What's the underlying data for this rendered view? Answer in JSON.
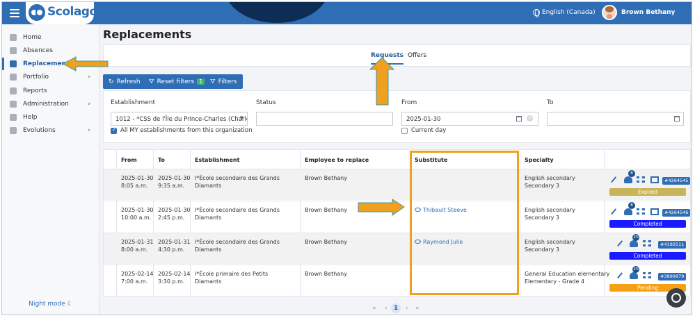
{
  "header": {
    "brand": "Scolago",
    "language": "English (Canada)",
    "user_name": "Brown Bethany"
  },
  "sidebar": {
    "items": [
      {
        "label": "Home",
        "icon": "home-icon",
        "has_submenu": false,
        "active": false
      },
      {
        "label": "Absences",
        "icon": "absences-icon",
        "has_submenu": false,
        "active": false
      },
      {
        "label": "Replacements",
        "icon": "replacements-icon",
        "has_submenu": false,
        "active": true
      },
      {
        "label": "Portfolio",
        "icon": "trophy-icon",
        "has_submenu": true,
        "active": false
      },
      {
        "label": "Reports",
        "icon": "document-icon",
        "has_submenu": false,
        "active": false
      },
      {
        "label": "Administration",
        "icon": "gear-icon",
        "has_submenu": true,
        "active": false
      },
      {
        "label": "Help",
        "icon": "question-icon",
        "has_submenu": false,
        "active": false
      },
      {
        "label": "Evolutions",
        "icon": "sprout-icon",
        "has_submenu": true,
        "active": false
      }
    ],
    "night_mode": "Night mode"
  },
  "page": {
    "title": "Replacements",
    "tabs": [
      {
        "label": "Requests",
        "active": true
      },
      {
        "label": "Offers",
        "active": false
      }
    ]
  },
  "toolbar": {
    "refresh": "Refresh",
    "reset_filters": "Reset filters",
    "reset_filters_count": "1",
    "filters": "Filters"
  },
  "filters": {
    "establishment_label": "Establishment",
    "establishment_value": "1012 - *CSS de l'Île du Prince-Charles (Charle...",
    "all_establishments_label": "All MY establishments from this organization",
    "all_establishments_checked": true,
    "status_label": "Status",
    "status_value": "",
    "from_label": "From",
    "from_value": "2025-01-30",
    "current_day_label": "Current day",
    "current_day_checked": false,
    "to_label": "To",
    "to_value": ""
  },
  "table": {
    "headers": [
      "From",
      "To",
      "Establishment",
      "Employee to replace",
      "Substitute",
      "Specialty"
    ],
    "rows": [
      {
        "from_date": "2025-01-30",
        "from_time": "8:05 a.m.",
        "to_date": "2025-01-30",
        "to_time": "9:35 a.m.",
        "est_1": "l*École secondaire des Grands",
        "est_2": "Diamants",
        "employee": "Brown Bethany",
        "substitute": "",
        "spec_1": "English secondary",
        "spec_2": "Secondary 3",
        "count": "8",
        "ref": "#4264545",
        "status": "Expired",
        "status_color": "#c8b45a"
      },
      {
        "from_date": "2025-01-30",
        "from_time": "10:00 a.m.",
        "to_date": "2025-01-30",
        "to_time": "2:45 p.m.",
        "est_1": "l*École secondaire des Grands",
        "est_2": "Diamants",
        "employee": "Brown Bethany",
        "substitute": "Thibault Steeve",
        "spec_1": "English secondary",
        "spec_2": "Secondary 3",
        "count": "8",
        "ref": "#4264546",
        "status": "Completed",
        "status_color": "#1a1aff"
      },
      {
        "from_date": "2025-01-31",
        "from_time": "8:00 a.m.",
        "to_date": "2025-01-31",
        "to_time": "4:30 p.m.",
        "est_1": "l*École secondaire des Grands",
        "est_2": "Diamants",
        "employee": "Brown Bethany",
        "substitute": "Raymond Julie",
        "spec_1": "English secondary",
        "spec_2": "Secondary 3",
        "count": "20",
        "ref": "#4192511",
        "status": "Completed",
        "status_color": "#1a1aff"
      },
      {
        "from_date": "2025-02-14",
        "from_time": "7:00 a.m.",
        "to_date": "2025-02-14",
        "to_time": "3:30 p.m.",
        "est_1": "l*École primaire des Petits",
        "est_2": "Diamants",
        "employee": "Brown Bethany",
        "substitute": "",
        "spec_1": "General Education elementary",
        "spec_2": "Elementary - Grade 4",
        "count": "20",
        "ref": "#3899979",
        "status": "Pending",
        "status_color": "#f5a015"
      }
    ]
  },
  "pager": {
    "first": "«",
    "prev": "‹",
    "current": "1",
    "next": "›",
    "last": "»"
  },
  "colors": {
    "brand_blue": "#2f6db5",
    "annotation_orange": "#f0a020"
  }
}
